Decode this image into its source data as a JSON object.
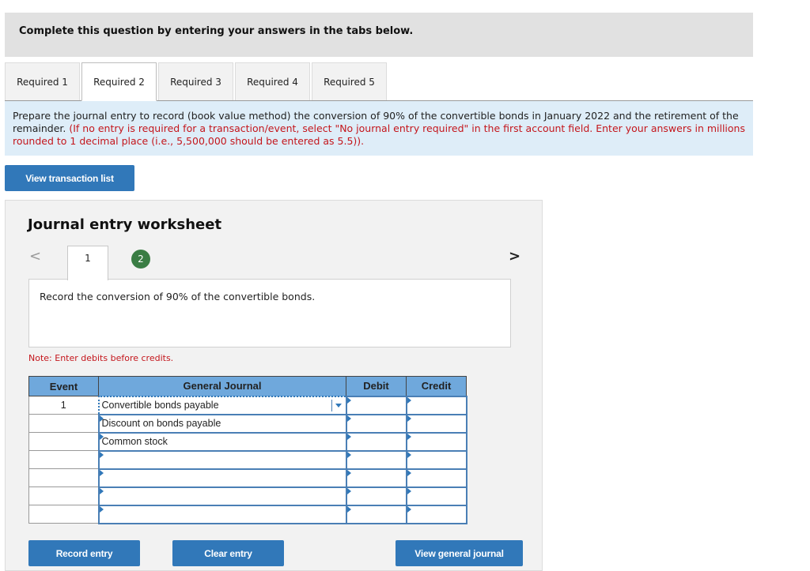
{
  "banner": {
    "text": "Complete this question by entering your answers in the tabs below."
  },
  "tabs": [
    {
      "label": "Required 1",
      "active": false
    },
    {
      "label": "Required 2",
      "active": true
    },
    {
      "label": "Required 3",
      "active": false
    },
    {
      "label": "Required 4",
      "active": false
    },
    {
      "label": "Required 5",
      "active": false
    }
  ],
  "instructions": {
    "main": "Prepare the journal entry to record (book value method) the conversion of 90% of the convertible bonds in January 2022 and the retirement of the remainder. ",
    "red": "(If no entry is required for a transaction/event, select \"No journal entry required\" in the first account field. Enter your answers in millions rounded to 1 decimal place (i.e., 5,500,000 should be entered as 5.5))."
  },
  "buttons": {
    "view_transaction_list": "View transaction list",
    "record_entry": "Record entry",
    "clear_entry": "Clear entry",
    "view_general_journal": "View general journal"
  },
  "worksheet": {
    "title": "Journal entry worksheet",
    "nav_prev": "<",
    "nav_next": ">",
    "steps": [
      "1",
      "2"
    ],
    "active_step": "1",
    "description": "Record the conversion of 90% of the convertible bonds.",
    "note": "Note: Enter debits before credits."
  },
  "journal": {
    "headers": {
      "event": "Event",
      "general_journal": "General Journal",
      "debit": "Debit",
      "credit": "Credit"
    },
    "rows": [
      {
        "event": "1",
        "account": "Convertible bonds payable",
        "debit": "",
        "credit": ""
      },
      {
        "event": "",
        "account": "Discount on bonds payable",
        "debit": "",
        "credit": ""
      },
      {
        "event": "",
        "account": "Common stock",
        "debit": "",
        "credit": ""
      },
      {
        "event": "",
        "account": "",
        "debit": "",
        "credit": ""
      },
      {
        "event": "",
        "account": "",
        "debit": "",
        "credit": ""
      },
      {
        "event": "",
        "account": "",
        "debit": "",
        "credit": ""
      },
      {
        "event": "",
        "account": "",
        "debit": "",
        "credit": ""
      }
    ]
  },
  "colors": {
    "button_blue": "#3178b9",
    "header_blue": "#6fa8dc",
    "instruction_bg": "#deedf8",
    "error_red": "#c4161c",
    "step_green": "#3a7d44"
  }
}
